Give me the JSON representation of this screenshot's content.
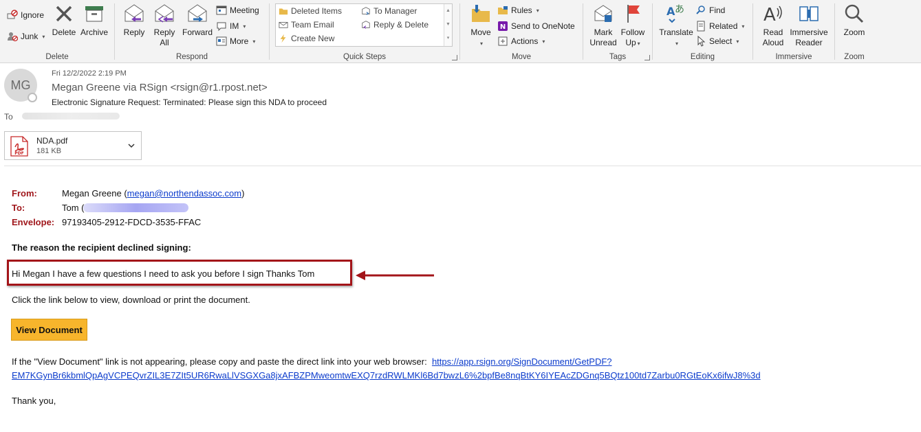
{
  "ribbon": {
    "delete_group": {
      "label": "Delete",
      "ignore": "Ignore",
      "junk": "Junk",
      "delete": "Delete",
      "archive": "Archive"
    },
    "respond_group": {
      "label": "Respond",
      "reply": "Reply",
      "reply_all_1": "Reply",
      "reply_all_2": "All",
      "forward": "Forward",
      "meeting": "Meeting",
      "im": "IM",
      "more": "More"
    },
    "quick_steps": {
      "label": "Quick Steps",
      "deleted_items": "Deleted Items",
      "to_manager": "To Manager",
      "team_email": "Team Email",
      "reply_delete": "Reply & Delete",
      "create_new": "Create New"
    },
    "move_group": {
      "label": "Move",
      "move": "Move",
      "rules": "Rules",
      "onenote": "Send to OneNote",
      "actions": "Actions"
    },
    "tags_group": {
      "label": "Tags",
      "mark_unread_1": "Mark",
      "mark_unread_2": "Unread",
      "follow_up_1": "Follow",
      "follow_up_2": "Up"
    },
    "editing_group": {
      "label": "Editing",
      "translate": "Translate",
      "find": "Find",
      "related": "Related",
      "select": "Select"
    },
    "immersive_group": {
      "label": "Immersive",
      "read_aloud_1": "Read",
      "read_aloud_2": "Aloud",
      "reader_1": "Immersive",
      "reader_2": "Reader"
    },
    "zoom_group": {
      "label": "Zoom",
      "zoom": "Zoom"
    }
  },
  "message": {
    "avatar_initials": "MG",
    "date": "Fri 12/2/2022 2:19 PM",
    "sender": "Megan Greene via RSign <rsign@r1.rpost.net>",
    "subject": "Electronic Signature Request: Terminated: Please sign this NDA to proceed",
    "to_label": "To",
    "attachment": {
      "name": "NDA.pdf",
      "size": "181 KB",
      "badge": "PDF"
    }
  },
  "body": {
    "from_label": "From:",
    "from_name": "Megan Greene (",
    "from_email": "megan@northendassoc.com",
    "from_close": ")",
    "to_label": "To:",
    "to_name": "Tom (",
    "envelope_label": "Envelope:",
    "envelope_id": "97193405-2912-FDCD-3535-FFAC",
    "reason_heading": "The reason the recipient declined signing:",
    "reason_text": "Hi Megan I have a few questions I need to ask you before I sign Thanks Tom",
    "click_text": "Click the link below to view, download or print the document.",
    "view_button": "View Document",
    "fallback_text": "If the \"View Document\" link is not appearing, please copy and paste the direct link into your web browser:",
    "link_line1": "https://app.rsign.org/SignDocument/GetPDF?",
    "link_line2": "EM7KGynBr6kbmlQpAgVCPEQvrZIL3E7ZIt5UR6RwaLlVSGXGa8jxAFBZPMweomtwEXQ7rzdRWLMKl6Bd7bwzL6%2bpfBe8nqBtKY6IYEAcZDGnq5BQtz100td7Zarbu0RGtEoKx6ifwJ8%3d",
    "thanks": "Thank you,"
  },
  "colors": {
    "label_red": "#a0171c",
    "highlight_box": "#a31419",
    "button_yellow": "#f7b52c",
    "link_blue": "#0b3bcc"
  }
}
